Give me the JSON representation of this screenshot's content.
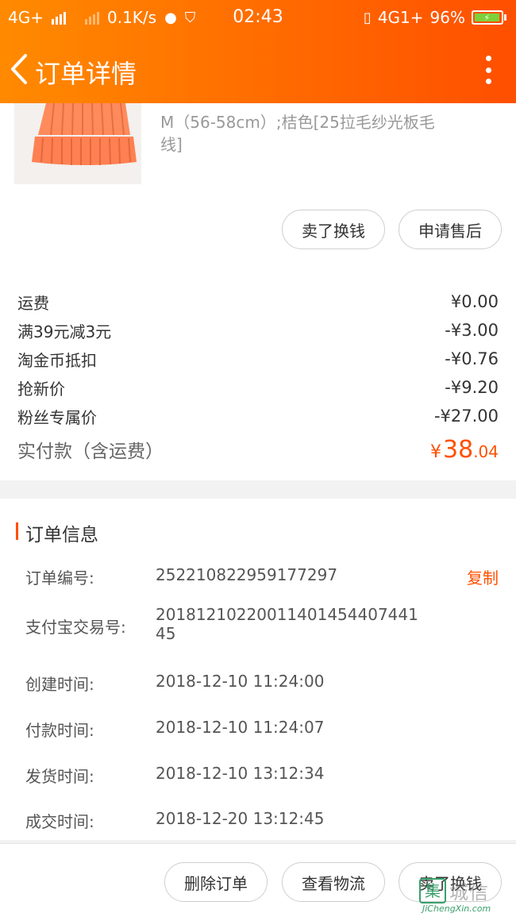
{
  "status_bar": {
    "network1": "4G+",
    "speed": "0.1K/s",
    "time": "02:43",
    "network2": "4G1+",
    "battery": "96%",
    "battery_level": 0.96
  },
  "header": {
    "title": "订单详情"
  },
  "product": {
    "sku": "M（56-58cm）;桔色[25拉毛纱光板毛线]",
    "buttons": {
      "sell": "卖了换钱",
      "after_sale": "申请售后"
    }
  },
  "fees": [
    {
      "label": "运费",
      "value": "¥0.00"
    },
    {
      "label": "满39元减3元",
      "value": "-¥3.00"
    },
    {
      "label": "淘金币抵扣",
      "value": "-¥0.76"
    },
    {
      "label": "抢新价",
      "value": "-¥9.20"
    },
    {
      "label": "粉丝专属价",
      "value": "-¥27.00"
    }
  ],
  "total": {
    "label": "实付款（含运费）",
    "yen": "¥",
    "integer": "38",
    "decimal": ".04"
  },
  "order_info": {
    "title": "订单信息",
    "copy": "复制",
    "rows": [
      {
        "k": "订单编号:",
        "v": "252210822959177297"
      },
      {
        "k": "支付宝交易号:",
        "v": "2018121022001140145440744145"
      },
      {
        "k": "创建时间:",
        "v": "2018-12-10 11:24:00"
      },
      {
        "k": "付款时间:",
        "v": "2018-12-10 11:24:07"
      },
      {
        "k": "发货时间:",
        "v": "2018-12-10 13:12:34"
      },
      {
        "k": "成交时间:",
        "v": "2018-12-20 13:12:45"
      }
    ]
  },
  "bottom_bar": {
    "delete": "删除订单",
    "logistics": "查看物流",
    "sell": "卖了换钱"
  },
  "watermark": {
    "logo": "集",
    "cn": "城信",
    "url": "JiChengXin.com"
  },
  "colors": {
    "accent": "#ff5000",
    "header_start": "#ff8a00",
    "header_end": "#ff4f00"
  }
}
